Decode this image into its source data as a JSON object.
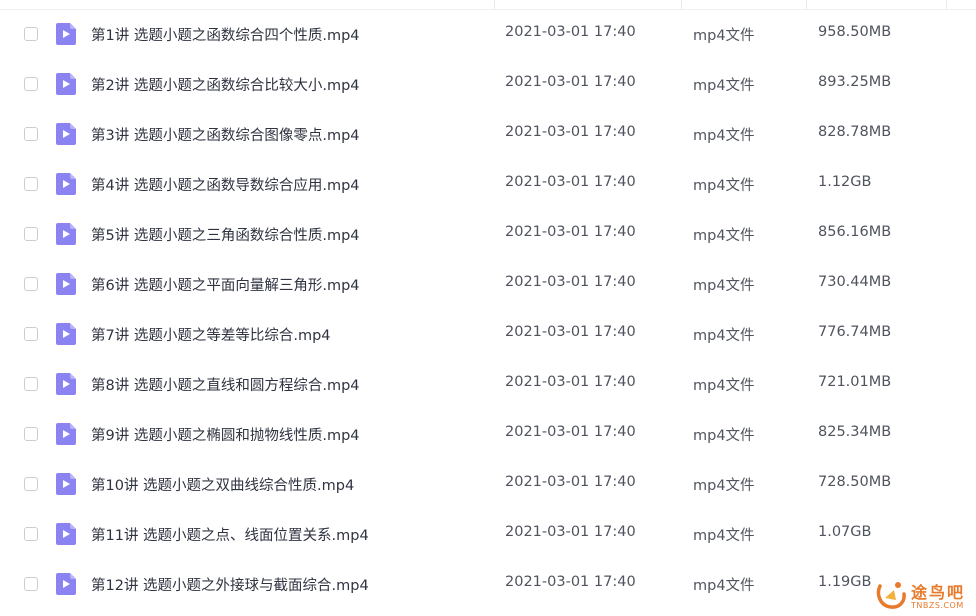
{
  "files": [
    {
      "name": "第1讲 选题小题之函数综合四个性质.mp4",
      "date": "2021-03-01 17:40",
      "type": "mp4文件",
      "size": "958.50MB"
    },
    {
      "name": "第2讲 选题小题之函数综合比较大小.mp4",
      "date": "2021-03-01 17:40",
      "type": "mp4文件",
      "size": "893.25MB"
    },
    {
      "name": "第3讲 选题小题之函数综合图像零点.mp4",
      "date": "2021-03-01 17:40",
      "type": "mp4文件",
      "size": "828.78MB"
    },
    {
      "name": "第4讲 选题小题之函数导数综合应用.mp4",
      "date": "2021-03-01 17:40",
      "type": "mp4文件",
      "size": "1.12GB"
    },
    {
      "name": "第5讲 选题小题之三角函数综合性质.mp4",
      "date": "2021-03-01 17:40",
      "type": "mp4文件",
      "size": "856.16MB"
    },
    {
      "name": "第6讲 选题小题之平面向量解三角形.mp4",
      "date": "2021-03-01 17:40",
      "type": "mp4文件",
      "size": "730.44MB"
    },
    {
      "name": "第7讲 选题小题之等差等比综合.mp4",
      "date": "2021-03-01 17:40",
      "type": "mp4文件",
      "size": "776.74MB"
    },
    {
      "name": "第8讲 选题小题之直线和圆方程综合.mp4",
      "date": "2021-03-01 17:40",
      "type": "mp4文件",
      "size": "721.01MB"
    },
    {
      "name": "第9讲 选题小题之椭圆和抛物线性质.mp4",
      "date": "2021-03-01 17:40",
      "type": "mp4文件",
      "size": "825.34MB"
    },
    {
      "name": "第10讲 选题小题之双曲线综合性质.mp4",
      "date": "2021-03-01 17:40",
      "type": "mp4文件",
      "size": "728.50MB"
    },
    {
      "name": "第11讲 选题小题之点、线面位置关系.mp4",
      "date": "2021-03-01 17:40",
      "type": "mp4文件",
      "size": "1.07GB"
    },
    {
      "name": "第12讲 选题小题之外接球与截面综合.mp4",
      "date": "2021-03-01 17:40",
      "type": "mp4文件",
      "size": "1.19GB"
    }
  ],
  "icons": {
    "checkbox": "checkbox-icon",
    "file": "video-file-icon"
  },
  "colors": {
    "file_icon": "#8b83f2",
    "text_primary": "#2f3340",
    "text_secondary": "#50545e",
    "watermark": "#e87a2c"
  },
  "watermark": {
    "text": "途鸟吧",
    "sub": "TNBZS.COM"
  }
}
